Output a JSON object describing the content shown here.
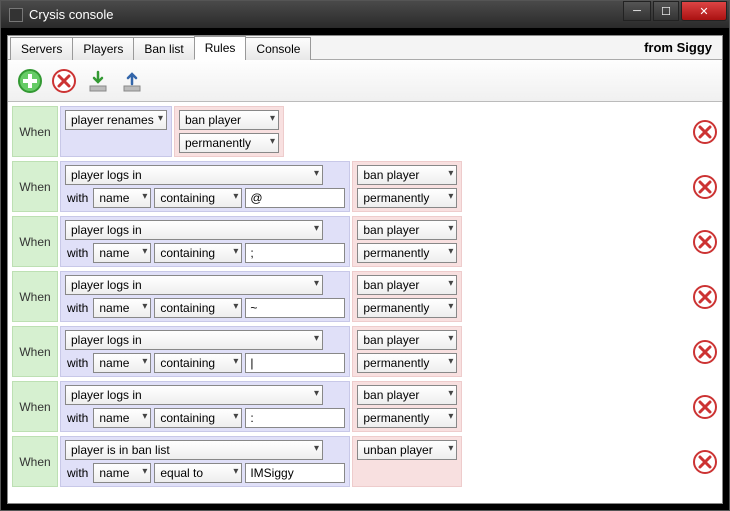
{
  "window": {
    "title": "Crysis console"
  },
  "tabs": [
    "Servers",
    "Players",
    "Ban list",
    "Rules",
    "Console"
  ],
  "active_tab": 3,
  "right_label": "from Siggy",
  "when_label": "When",
  "with_label": "with",
  "rules": [
    {
      "event": "player renames",
      "event_width": "med",
      "filters": [],
      "actions": [
        "ban player",
        "permanently"
      ]
    },
    {
      "event": "player logs in",
      "event_width": "wide",
      "filters": [
        {
          "field": "name",
          "op": "containing",
          "value": "@"
        }
      ],
      "actions": [
        "ban player",
        "permanently"
      ]
    },
    {
      "event": "player logs in",
      "event_width": "wide",
      "filters": [
        {
          "field": "name",
          "op": "containing",
          "value": ";"
        }
      ],
      "actions": [
        "ban player",
        "permanently"
      ]
    },
    {
      "event": "player logs in",
      "event_width": "wide",
      "filters": [
        {
          "field": "name",
          "op": "containing",
          "value": "~"
        }
      ],
      "actions": [
        "ban player",
        "permanently"
      ]
    },
    {
      "event": "player logs in",
      "event_width": "wide",
      "filters": [
        {
          "field": "name",
          "op": "containing",
          "value": "|"
        }
      ],
      "actions": [
        "ban player",
        "permanently"
      ]
    },
    {
      "event": "player logs in",
      "event_width": "wide",
      "filters": [
        {
          "field": "name",
          "op": "containing",
          "value": ":"
        }
      ],
      "actions": [
        "ban player",
        "permanently"
      ]
    },
    {
      "event": "player is in ban list",
      "event_width": "wide",
      "filters": [
        {
          "field": "name",
          "op": "equal to",
          "value": "IMSiggy"
        }
      ],
      "actions": [
        "unban player"
      ]
    }
  ]
}
